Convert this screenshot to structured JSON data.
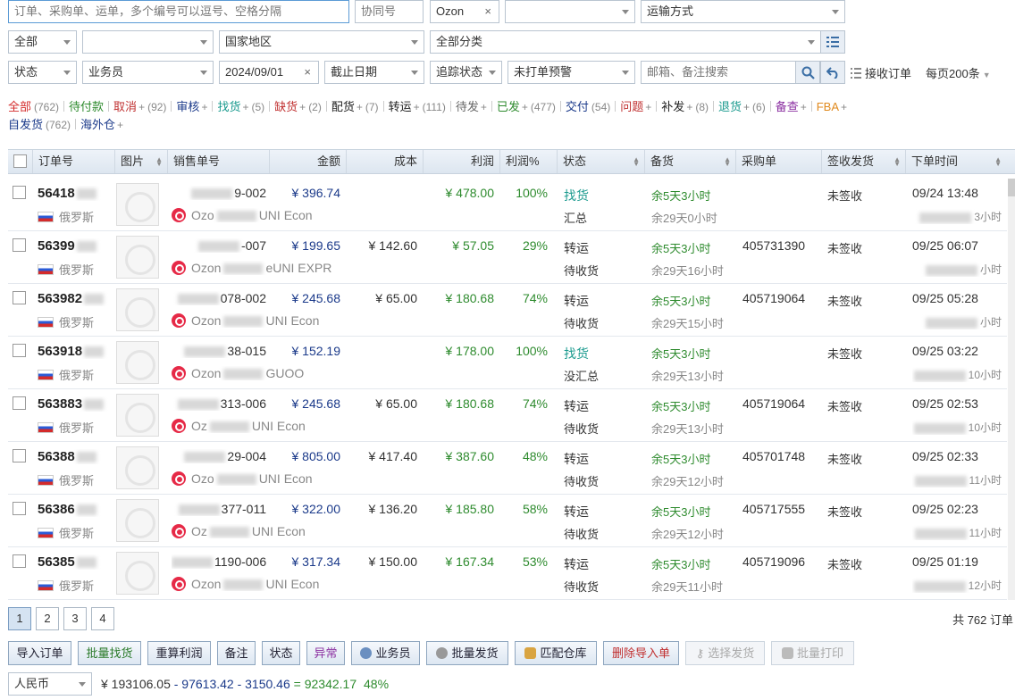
{
  "filters": {
    "order_search_placeholder": "订单、采购单、运单，多个编号可以逗号、空格分隔",
    "cooperation_no_placeholder": "协同号",
    "platform": "Ozon",
    "blank_select": "",
    "shipping_method": "运输方式",
    "all_label": "全部",
    "country_region": "国家地区",
    "all_categories": "全部分类",
    "status": "状态",
    "salesperson": "业务员",
    "start_date": "2024/09/01",
    "deadline_date": "截止日期",
    "tracking_status": "追踪状态",
    "unprinted_alert": "未打单预警",
    "email_note_search_placeholder": "邮箱、备注搜索",
    "receive_orders": "接收订单",
    "per_page": "每页200条"
  },
  "tabs": [
    {
      "label": "全部",
      "count": "(762)",
      "color": "#d42b2b"
    },
    {
      "label": "待付款",
      "count": "",
      "color": "#2e8b2e"
    },
    {
      "label": "取消",
      "count": "(92)",
      "plus": "+",
      "color": "#c03030"
    },
    {
      "label": "审核",
      "count": "",
      "plus": "+",
      "color": "#1b3a8a"
    },
    {
      "label": "找货",
      "count": "(5)",
      "plus": "+",
      "color": "#1a9a8e"
    },
    {
      "label": "缺货",
      "count": "(2)",
      "plus": "+",
      "color": "#c03030"
    },
    {
      "label": "配货",
      "count": "(7)",
      "plus": "+",
      "color": "#222"
    },
    {
      "label": "转运",
      "count": "(111)",
      "plus": "+",
      "color": "#222"
    },
    {
      "label": "待发",
      "count": "",
      "plus": "+",
      "color": "#666"
    },
    {
      "label": "已发",
      "count": "(477)",
      "plus": "+",
      "color": "#2e8b2e"
    },
    {
      "label": "交付",
      "count": "(54)",
      "color": "#1b3a8a"
    },
    {
      "label": "问题",
      "count": "",
      "plus": "+",
      "color": "#c03030"
    },
    {
      "label": "补发",
      "count": "(8)",
      "plus": "+",
      "color": "#222"
    },
    {
      "label": "退货",
      "count": "(6)",
      "plus": "+",
      "color": "#1a9a8e"
    },
    {
      "label": "备查",
      "count": "",
      "plus": "+",
      "color": "#8a2ea0"
    },
    {
      "label": "FBA",
      "count": "",
      "plus": "+",
      "color": "#e08a1e"
    }
  ],
  "tabs2": [
    {
      "label": "自发货",
      "count": "(762)",
      "color": "#1b3a8a"
    },
    {
      "label": "海外仓",
      "count": "",
      "plus": "+",
      "color": "#1b3a8a"
    }
  ],
  "columns": {
    "order_no": "订单号",
    "image": "图片",
    "sales_no": "销售单号",
    "amount": "金额",
    "cost": "成本",
    "profit": "利润",
    "profit_pct": "利润%",
    "status": "状态",
    "stock": "备货",
    "purchase": "采购单",
    "sign": "签收发货",
    "order_time": "下单时间"
  },
  "rows": [
    {
      "oid": "56418",
      "country": "俄罗斯",
      "sales_tail": "9-002",
      "sales2_pre": "Ozo",
      "sales2_tail": "UNI Econ",
      "amount": "¥ 396.74",
      "cost": "",
      "profit": "¥ 478.00",
      "pct": "100%",
      "status": "找货",
      "status_class": "teal",
      "sub_status": "汇总",
      "stock": "余5天3小时",
      "stock2": "余29天0小时",
      "purchase": "",
      "sign": "未签收",
      "time": "09/24 13:48",
      "time2": "3小时"
    },
    {
      "oid": "56399",
      "country": "俄罗斯",
      "sales_tail": "-007",
      "sales2_pre": "Ozon",
      "sales2_tail": "eUNI EXPR",
      "amount": "¥ 199.65",
      "cost": "¥ 142.60",
      "profit": "¥ 57.05",
      "pct": "29%",
      "status": "转运",
      "status_class": "num",
      "sub_status": "待收货",
      "stock": "余5天3小时",
      "stock2": "余29天16小时",
      "purchase": "405731390",
      "sign": "未签收",
      "time": "09/25 06:07",
      "time2": "小时"
    },
    {
      "oid": "563982",
      "country": "俄罗斯",
      "sales_tail": "078-002",
      "sales2_pre": "Ozon",
      "sales2_tail": "UNI Econ",
      "amount": "¥ 245.68",
      "cost": "¥ 65.00",
      "profit": "¥ 180.68",
      "pct": "74%",
      "status": "转运",
      "status_class": "num",
      "sub_status": "待收货",
      "stock": "余5天3小时",
      "stock2": "余29天15小时",
      "purchase": "405719064",
      "sign": "未签收",
      "time": "09/25 05:28",
      "time2": "小时"
    },
    {
      "oid": "563918",
      "country": "俄罗斯",
      "sales_tail": "38-015",
      "sales2_pre": "Ozon",
      "sales2_tail": "GUOO",
      "amount": "¥ 152.19",
      "cost": "",
      "profit": "¥ 178.00",
      "pct": "100%",
      "status": "找货",
      "status_class": "teal",
      "sub_status": "没汇总",
      "stock": "余5天3小时",
      "stock2": "余29天13小时",
      "purchase": "",
      "sign": "未签收",
      "time": "09/25 03:22",
      "time2": "10小时"
    },
    {
      "oid": "563883",
      "country": "俄罗斯",
      "sales_tail": "313-006",
      "sales2_pre": "Oz",
      "sales2_tail": "UNI Econ",
      "amount": "¥ 245.68",
      "cost": "¥ 65.00",
      "profit": "¥ 180.68",
      "pct": "74%",
      "status": "转运",
      "status_class": "num",
      "sub_status": "待收货",
      "stock": "余5天3小时",
      "stock2": "余29天13小时",
      "purchase": "405719064",
      "sign": "未签收",
      "time": "09/25 02:53",
      "time2": "10小时"
    },
    {
      "oid": "56388",
      "country": "俄罗斯",
      "sales_tail": "29-004",
      "sales2_pre": "Ozo",
      "sales2_tail": "UNI Econ",
      "amount": "¥ 805.00",
      "cost": "¥ 417.40",
      "profit": "¥ 387.60",
      "pct": "48%",
      "status": "转运",
      "status_class": "num",
      "sub_status": "待收货",
      "stock": "余5天3小时",
      "stock2": "余29天12小时",
      "purchase": "405701748",
      "sign": "未签收",
      "time": "09/25 02:33",
      "time2": "11小时"
    },
    {
      "oid": "56386",
      "country": "俄罗斯",
      "sales_tail": "377-011",
      "sales2_pre": "Oz",
      "sales2_tail": "UNI Econ",
      "amount": "¥ 322.00",
      "cost": "¥ 136.20",
      "profit": "¥ 185.80",
      "pct": "58%",
      "status": "转运",
      "status_class": "num",
      "sub_status": "待收货",
      "stock": "余5天3小时",
      "stock2": "余29天12小时",
      "purchase": "405717555",
      "sign": "未签收",
      "time": "09/25 02:23",
      "time2": "11小时"
    },
    {
      "oid": "56385",
      "country": "俄罗斯",
      "sales_tail": "1190-006",
      "sales2_pre": "Ozon",
      "sales2_tail": "UNI Econ",
      "amount": "¥ 317.34",
      "cost": "¥ 150.00",
      "profit": "¥ 167.34",
      "pct": "53%",
      "status": "转运",
      "status_class": "num",
      "sub_status": "待收货",
      "stock": "余5天3小时",
      "stock2": "余29天11小时",
      "purchase": "405719096",
      "sign": "未签收",
      "time": "09/25 01:19",
      "time2": "12小时"
    }
  ],
  "pagination": {
    "pages": [
      "1",
      "2",
      "3",
      "4"
    ],
    "current": "1",
    "total": "共 762 订单"
  },
  "actions": {
    "import": "导入订单",
    "batch_find": "批量找货",
    "recalc": "重算利润",
    "note": "备注",
    "status": "状态",
    "abnormal": "异常",
    "salesperson": "业务员",
    "batch_ship": "批量发货",
    "match_wh": "匹配仓库",
    "delete_import": "删除导入单",
    "select_ship": "选择发货",
    "batch_print": "批量打印"
  },
  "summary": {
    "currency": "人民币",
    "total": "¥ 193106.05",
    "minus1": "- 97613.42",
    "minus2": "- 3150.46",
    "eq": "= 92342.17",
    "pct": "48%"
  }
}
